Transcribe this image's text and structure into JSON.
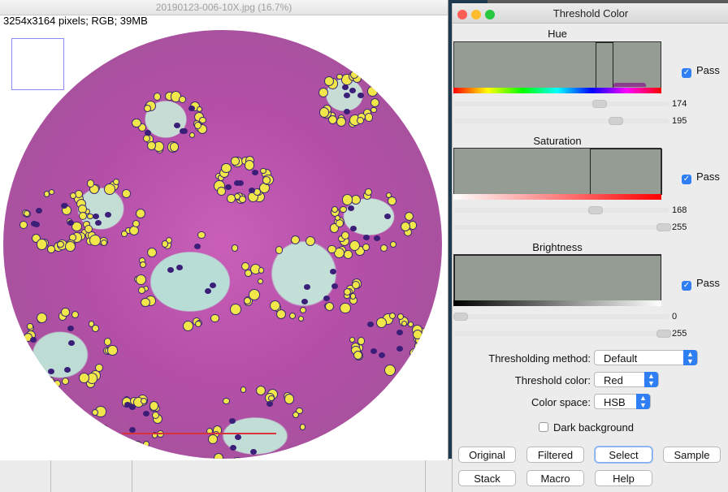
{
  "image_window": {
    "title": "20190123-006-10X.jpg (16.7%)",
    "info": "3254x3164 pixels; RGB; 39MB"
  },
  "panel": {
    "title": "Threshold Color",
    "hue": {
      "label": "Hue",
      "pass_label": "Pass",
      "pass_checked": true,
      "min": "174",
      "max": "195"
    },
    "saturation": {
      "label": "Saturation",
      "pass_label": "Pass",
      "pass_checked": true,
      "min": "168",
      "max": "255"
    },
    "brightness": {
      "label": "Brightness",
      "pass_label": "Pass",
      "pass_checked": true,
      "min": "0",
      "max": "255"
    },
    "method": {
      "label": "Thresholding method:",
      "value": "Default"
    },
    "color": {
      "label": "Threshold color:",
      "value": "Red"
    },
    "space": {
      "label": "Color space:",
      "value": "HSB"
    },
    "dark_bg": {
      "label": "Dark background",
      "checked": false
    },
    "buttons": {
      "original": "Original",
      "filtered": "Filtered",
      "select": "Select",
      "sample": "Sample",
      "stack": "Stack",
      "macro": "Macro",
      "help": "Help"
    },
    "checkmark": "✓"
  },
  "colors": {
    "accent": "#2f7ef3",
    "red_light": "#fd5f57",
    "yellow_light": "#febc2e",
    "green_light": "#28c840"
  }
}
